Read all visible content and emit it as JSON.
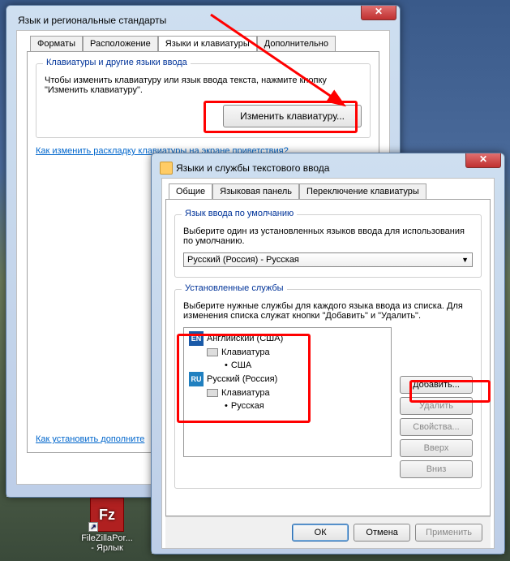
{
  "window1": {
    "title": "Язык и региональные стандарты",
    "tabs": [
      "Форматы",
      "Расположение",
      "Языки и клавиатуры",
      "Дополнительно"
    ],
    "active_tab": 2,
    "group_title": "Клавиатуры и другие языки ввода",
    "group_text": "Чтобы изменить клавиатуру или язык ввода текста, нажмите кнопку \"Изменить клавиатуру\".",
    "change_kb_btn": "Изменить клавиатуру...",
    "link1": "Как изменить раскладку клавиатуры на экране приветствия?",
    "link2": "Как установить дополните"
  },
  "window2": {
    "title": "Языки и службы текстового ввода",
    "tabs": [
      "Общие",
      "Языковая панель",
      "Переключение клавиатуры"
    ],
    "active_tab": 0,
    "default_group_title": "Язык ввода по умолчанию",
    "default_group_text": "Выберите один из установленных языков ввода для использования по умолчанию.",
    "default_combo": "Русский (Россия) - Русская",
    "services_group_title": "Установленные службы",
    "services_group_text": "Выберите нужные службы для каждого языка ввода из списка. Для изменения списка служат кнопки \"Добавить\" и \"Удалить\".",
    "tree": {
      "en_badge": "EN",
      "en_lang": "Английский (США)",
      "kb_label": "Клавиатура",
      "en_layout": "США",
      "ru_badge": "RU",
      "ru_lang": "Русский (Россия)",
      "ru_layout": "Русская"
    },
    "side_buttons": {
      "add": "Добавить...",
      "remove": "Удалить",
      "props": "Свойства...",
      "up": "Вверх",
      "down": "Вниз"
    },
    "ok": "ОК",
    "cancel": "Отмена",
    "apply": "Применить"
  },
  "desktop": {
    "label1": "FileZillaPor...",
    "label2": "- Ярлык"
  }
}
